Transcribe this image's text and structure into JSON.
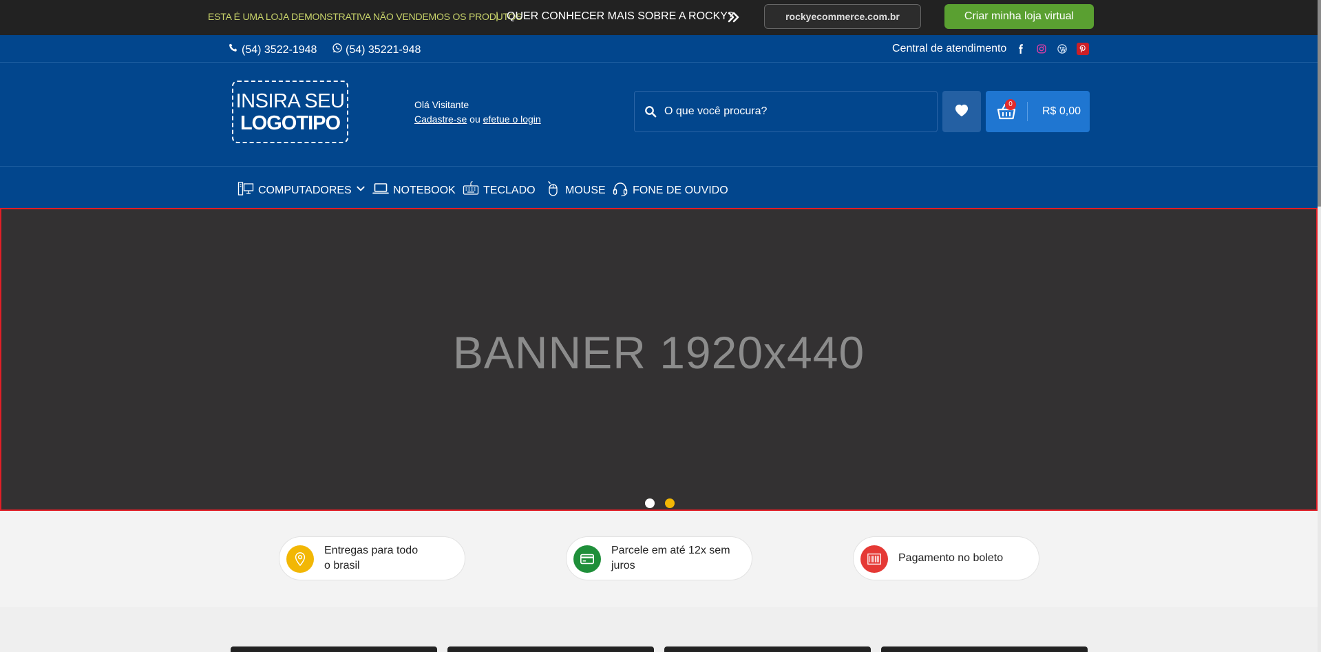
{
  "promo": {
    "demo_text": "ESTA É UMA LOJA DEMONSTRATIVA NÃO VENDEMOS OS PRODUTOS",
    "separator": "|",
    "question": "QUER CONHECER MAIS SOBRE A ROCKY?",
    "domain_label": "rockyecommerce.com.br",
    "create_button": "Criar minha loja virtual",
    "colors": {
      "demo_text": "#c8d36a",
      "create_button": "#5aa031"
    }
  },
  "contact": {
    "phone": "(54) 3522-1948",
    "whatsapp": "(54) 35221-948",
    "central": "Central de atendimento",
    "social_icons": [
      "facebook-icon",
      "instagram-icon",
      "wordpress-icon",
      "pinterest-icon"
    ]
  },
  "logo": {
    "line1": "INSIRA SEU",
    "line2": "LOGOTIPO"
  },
  "visitor": {
    "greeting": "Olá Visitante",
    "register_link": "Cadastre-se",
    "or": "ou",
    "login_link": "efetue o login"
  },
  "search": {
    "placeholder": "O que você procura?"
  },
  "cart": {
    "count": "0",
    "total": "R$ 0,00"
  },
  "nav": {
    "items": [
      {
        "label": "COMPUTADORES",
        "icon": "computer-icon",
        "has_dropdown": true
      },
      {
        "label": "NOTEBOOK",
        "icon": "laptop-icon"
      },
      {
        "label": "TECLADO",
        "icon": "keyboard-icon"
      },
      {
        "label": "MOUSE",
        "icon": "mouse-icon"
      },
      {
        "label": "FONE DE OUVIDO",
        "icon": "headphones-icon"
      }
    ]
  },
  "banner": {
    "text": "BANNER 1920x440",
    "active_dot": 2,
    "dots": 2
  },
  "benefits": [
    {
      "line1": "Entregas para todo",
      "line2": "o brasil",
      "icon": "location-pin-icon",
      "color": "#f2b705"
    },
    {
      "line1": "Parcele em até 12x sem",
      "line2": "juros",
      "icon": "credit-card-icon",
      "color": "#1f8f3a"
    },
    {
      "line1": "Pagamento no boleto",
      "line2": "",
      "icon": "barcode-icon",
      "color": "#e53935"
    }
  ],
  "theme": {
    "header_blue": "#02468d",
    "cart_blue": "#1f76d1",
    "banner_bg": "#333132"
  }
}
